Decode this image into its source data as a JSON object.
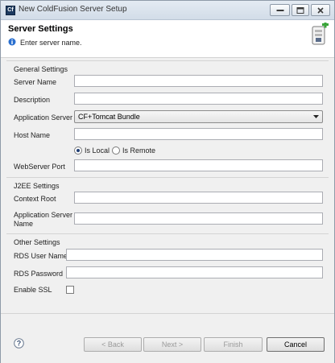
{
  "window": {
    "title": "New ColdFusion Server Setup",
    "app_icon_text": "Cf"
  },
  "header": {
    "title": "Server Settings",
    "message": "Enter server name."
  },
  "general": {
    "title": "General Settings",
    "server_name_label": "Server Name",
    "server_name_value": "",
    "description_label": "Description",
    "description_value": "",
    "app_server_label": "Application Server",
    "app_server_value": "CF+Tomcat Bundle",
    "host_name_label": "Host Name",
    "host_name_value": "",
    "is_local_label": "Is Local",
    "is_remote_label": "Is Remote",
    "webserver_port_label": "WebServer Port",
    "webserver_port_value": ""
  },
  "j2ee": {
    "title": "J2EE Settings",
    "context_root_label": "Context Root",
    "context_root_value": "",
    "app_server_name_label": "Application Server Name",
    "app_server_name_value": ""
  },
  "other": {
    "title": "Other Settings",
    "rds_user_label": "RDS User Name",
    "rds_user_value": "",
    "rds_password_label": "RDS Password",
    "rds_password_value": "",
    "enable_ssl_label": "Enable SSL"
  },
  "footer": {
    "back_label": "< Back",
    "next_label": "Next >",
    "finish_label": "Finish",
    "cancel_label": "Cancel"
  },
  "icons": {
    "app": "coldfusion-logo-icon",
    "minimize": "minimize-icon",
    "maximize": "maximize-icon",
    "close": "close-icon",
    "info": "info-icon",
    "server": "server-add-icon",
    "dropdown": "chevron-down-icon",
    "help": "help-icon"
  },
  "colors": {
    "titlebar": "#d9e3ee",
    "dialog_bg": "#f0f0f0",
    "header_bg": "#ffffff",
    "info_blue": "#2a6fcf",
    "server_green": "#3aa53a"
  }
}
